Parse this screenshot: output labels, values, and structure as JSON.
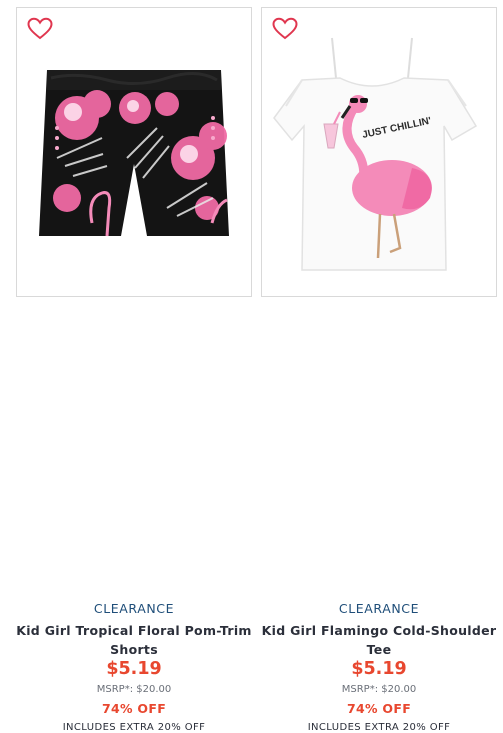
{
  "colors": {
    "badge": "#1f4e79",
    "sale": "#e8472f",
    "name": "#2b2f3a",
    "muted": "#6a6f78",
    "heart": "#e0364f"
  },
  "products": [
    {
      "badge": "CLEARANCE",
      "name": "Kid Girl Tropical Floral Pom-Trim Shorts",
      "price": "$5.19",
      "msrp": "MSRP*: $20.00",
      "discount": "74% OFF",
      "promo": "INCLUDES EXTRA 20% OFF",
      "favorite_icon": "heart-outline-icon"
    },
    {
      "badge": "CLEARANCE",
      "name": "Kid Girl Flamingo Cold-Shoulder Tee",
      "price": "$5.19",
      "msrp": "MSRP*: $20.00",
      "discount": "74% OFF",
      "promo": "INCLUDES EXTRA 20% OFF",
      "favorite_icon": "heart-outline-icon",
      "graphic_text": "JUST CHILLIN'"
    }
  ]
}
